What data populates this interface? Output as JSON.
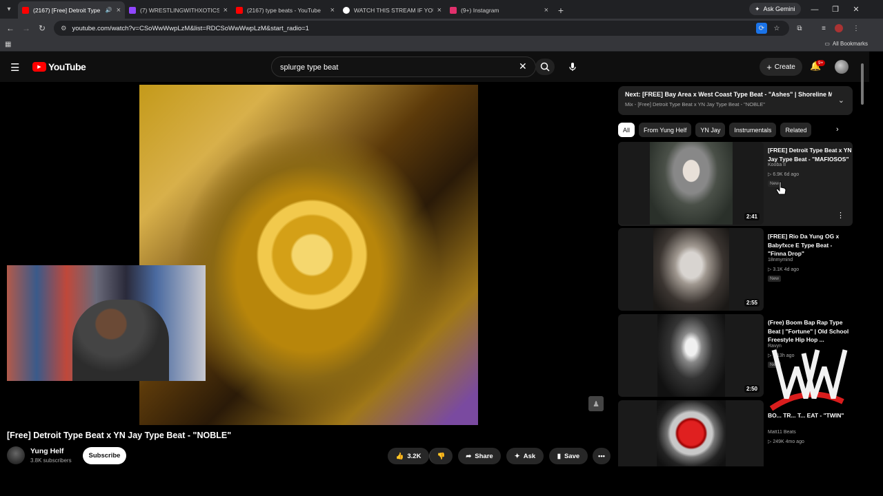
{
  "browser": {
    "tabs": [
      {
        "title": "(2167) [Free] Detroit Type B",
        "color": "#ff0000",
        "active": true
      },
      {
        "title": "(7) WRESTLINGWITHXOTICSLIV",
        "color": "#9146ff",
        "active": false
      },
      {
        "title": "(2167) type beats - YouTube",
        "color": "#ff0000",
        "active": false
      },
      {
        "title": "WATCH THIS STREAM IF YOU A",
        "color": "#ffffff",
        "active": false
      },
      {
        "title": "(9+) Instagram",
        "color": "#e1306c",
        "active": false
      }
    ],
    "ask_gemini": "Ask Gemini",
    "url": "youtube.com/watch?v=CSoWwWwpLzM&list=RDCSoWwWwpLzM&start_radio=1",
    "all_bookmarks": "All Bookmarks"
  },
  "header": {
    "logo_text": "YouTube",
    "search_value": "splurge type beat",
    "create_label": "Create",
    "notif_badge": "9+"
  },
  "video": {
    "title": "[Free] Detroit Type Beat x YN Jay Type Beat - \"NOBLE\"",
    "channel": "Yung Helf",
    "subscribers": "3.8K subscribers",
    "subscribe_label": "Subscribe",
    "likes": "3.2K",
    "share_label": "Share",
    "ask_label": "Ask",
    "save_label": "Save"
  },
  "sidebar": {
    "next_title": "Next: [FREE] Bay Area x West Coast Type Beat - \"Ashes\" | Shoreline Ma...",
    "next_sub": "Mix - [Free] Detroit Type Beat x YN Jay Type Beat - \"NOBLE\"",
    "chips": [
      "All",
      "From Yung Helf",
      "YN Jay",
      "Instrumentals",
      "Related"
    ],
    "recs": [
      {
        "title": "[FREE] Detroit Type Beat x YN Jay Type Beat - \"MAFIOSOS\"",
        "channel": "Kooba II",
        "meta": "▷ 6.9K  6d ago",
        "new": "New",
        "duration": "2:41"
      },
      {
        "title": "[FREE] Rio Da Yung OG x Babyfxce E Type Beat - \"Finna Drop\"",
        "channel": "18nmymind",
        "meta": "▷ 3.1K  4d ago",
        "new": "New",
        "duration": "2:55"
      },
      {
        "title": "(Free) Boom Bap Rap Type Beat | \"Fortune\" | Old School Freestyle Hip Hop ...",
        "channel": "Ravyn",
        "meta": "▷ 5  13h ago",
        "new": "New",
        "duration": "2:50"
      },
      {
        "title": "BO... TR... T... EAT - \"TWIN\"",
        "channel": "Matt11 Beats",
        "meta": "▷ 249K  4mo ago",
        "new": "",
        "duration": ""
      }
    ]
  }
}
